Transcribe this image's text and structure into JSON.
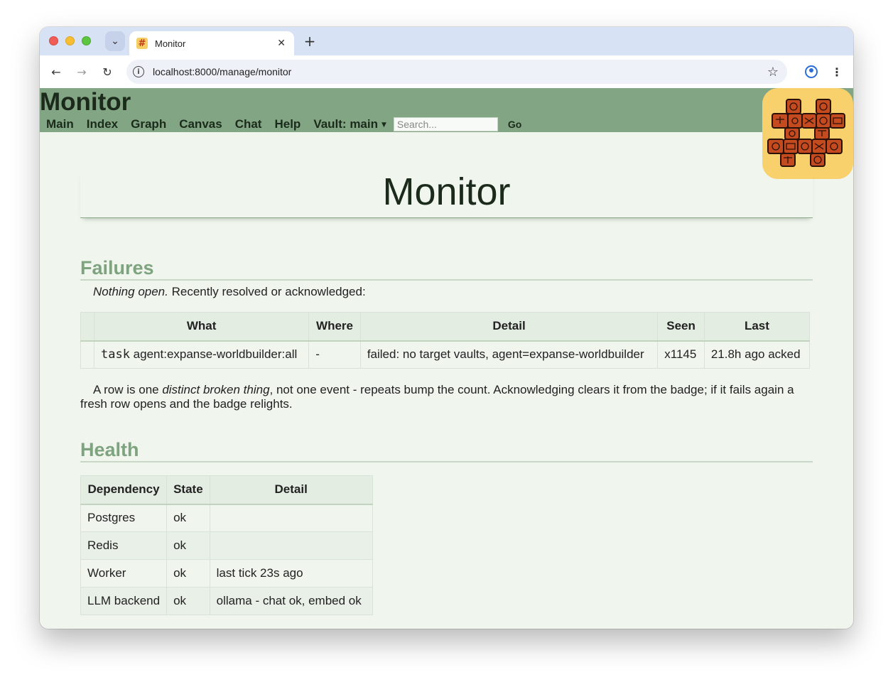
{
  "browser": {
    "tab_title": "Monitor",
    "favicon": "#",
    "url": "localhost:8000/manage/monitor",
    "icons": [
      "tab-dropdown-icon",
      "close-icon",
      "plus-icon",
      "back-arrow-icon",
      "forward-arrow-icon",
      "reload-icon",
      "info-icon",
      "star-icon",
      "profile-icon",
      "kebab-menu-icon"
    ]
  },
  "header": {
    "site_title": "Monitor",
    "nav": [
      "Main",
      "Index",
      "Graph",
      "Canvas",
      "Chat",
      "Help"
    ],
    "vault_label": "Vault: main",
    "search_placeholder": "Search...",
    "go_label": "Go",
    "bg_color": "#82a683",
    "logo_color": "#f8d06c"
  },
  "page": {
    "title": "Monitor"
  },
  "failures": {
    "heading": "Failures",
    "intro_em": "Nothing open.",
    "intro_rest": " Recently resolved or acknowledged:",
    "columns": [
      "",
      "What",
      "Where",
      "Detail",
      "Seen",
      "Last"
    ],
    "rows": [
      {
        "marker": "",
        "kind": "task",
        "what": " agent:expanse-worldbuilder:all",
        "where": "-",
        "detail": "failed: no target vaults, agent=expanse-worldbuilder",
        "seen": "x1145",
        "last": "21.8h ago acked"
      }
    ],
    "note_start": "A row is one ",
    "note_em": "distinct broken thing",
    "note_end": ", not one event - repeats bump the count. Acknowledging clears it from the badge; if it fails again a fresh row opens and the badge relights."
  },
  "health": {
    "heading": "Health",
    "columns": [
      "Dependency",
      "State",
      "Detail"
    ],
    "rows": [
      {
        "dependency": "Postgres",
        "state": "ok",
        "detail": ""
      },
      {
        "dependency": "Redis",
        "state": "ok",
        "detail": ""
      },
      {
        "dependency": "Worker",
        "state": "ok",
        "detail": "last tick 23s ago"
      },
      {
        "dependency": "LLM backend",
        "state": "ok",
        "detail": "ollama - chat ok, embed ok"
      }
    ]
  }
}
